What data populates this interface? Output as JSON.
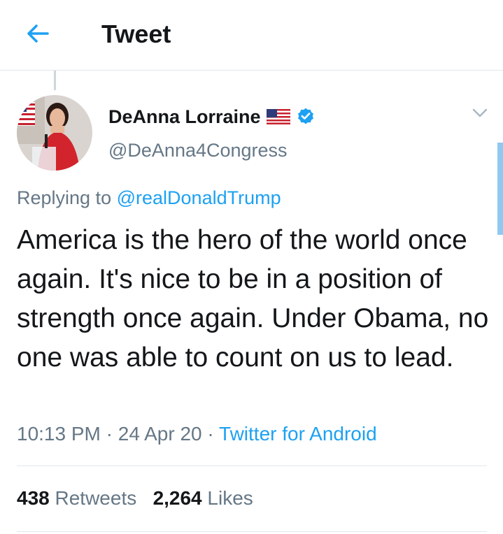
{
  "header": {
    "title": "Tweet",
    "back_icon": "arrow-left-icon",
    "accent": "#1da1f2"
  },
  "author": {
    "name": "DeAnna Lorraine",
    "handle": "@DeAnna4Congress",
    "flag_icon": "us-flag-icon",
    "verified_icon": "verified-badge-icon"
  },
  "reply": {
    "prefix": "Replying to",
    "mention": "@realDonaldTrump"
  },
  "tweet": {
    "text": "America is the hero of the world once again. It's nice to be in a position of strength once again. Under Obama, no one was able to count on us to lead."
  },
  "meta": {
    "time": "10:13 PM",
    "sep1": "·",
    "date": "24 Apr 20",
    "sep2": "·",
    "source": "Twitter for Android"
  },
  "stats": {
    "retweets_count": "438",
    "retweets_label": "Retweets",
    "likes_count": "2,264",
    "likes_label": "Likes"
  }
}
